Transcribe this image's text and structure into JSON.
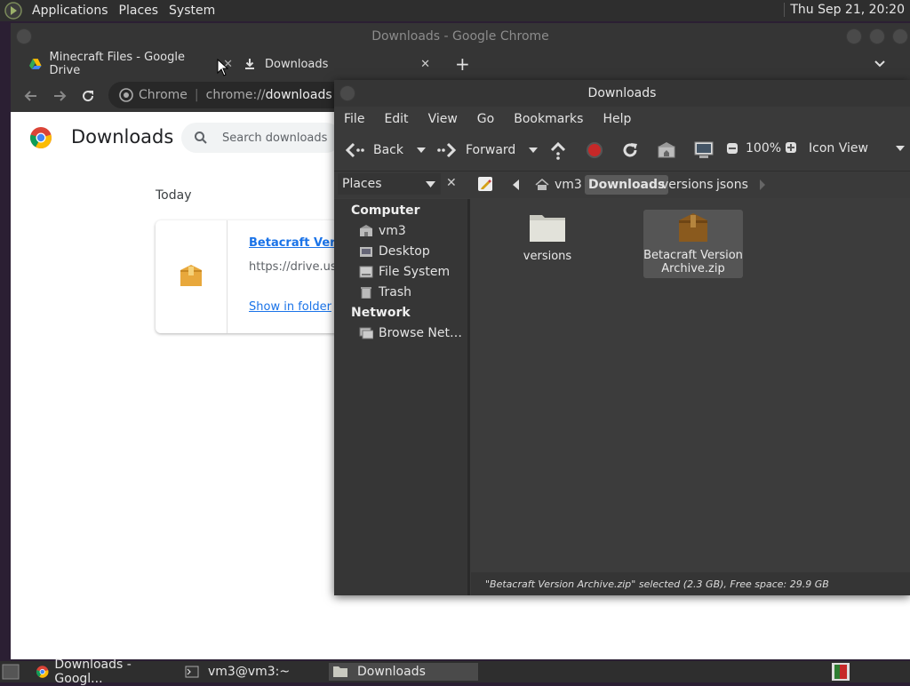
{
  "top_panel": {
    "menus": [
      "Applications",
      "Places",
      "System"
    ],
    "clock": "Thu Sep 21, 20:20"
  },
  "chrome": {
    "window_title": "Downloads - Google Chrome",
    "tabs": [
      {
        "label": "Minecraft Files - Google Drive"
      },
      {
        "label": "Downloads"
      }
    ],
    "omnibox": {
      "site": "Chrome",
      "url_prefix": "chrome://",
      "url_path": "downloads"
    },
    "page": {
      "title": "Downloads",
      "search_placeholder": "Search downloads",
      "date_group": "Today",
      "item": {
        "filename": "Betacraft Version",
        "url": "https://drive.user",
        "action": "Show in folder"
      }
    }
  },
  "file_manager": {
    "title": "Downloads",
    "menu": [
      "File",
      "Edit",
      "View",
      "Go",
      "Bookmarks",
      "Help"
    ],
    "toolbar": {
      "back": "Back",
      "forward": "Forward",
      "zoom": "100%",
      "view_mode": "Icon View"
    },
    "places_label": "Places",
    "breadcrumbs": [
      "vm3",
      "Downloads",
      "versions",
      "jsons"
    ],
    "sidebar": {
      "computer_header": "Computer",
      "computer_items": [
        "vm3",
        "Desktop",
        "File System",
        "Trash"
      ],
      "network_header": "Network",
      "network_items": [
        "Browse Net…"
      ]
    },
    "files": [
      {
        "name": "versions",
        "type": "folder"
      },
      {
        "name_line1": "Betacraft Version",
        "name_line2": "Archive.zip",
        "type": "archive",
        "selected": true
      }
    ],
    "status": "\"Betacraft Version Archive.zip\" selected (2.3 GB), Free space: 29.9 GB"
  },
  "bottom_panel": {
    "tasks": [
      "Downloads - Googl...",
      "vm3@vm3:~",
      "Downloads"
    ]
  }
}
